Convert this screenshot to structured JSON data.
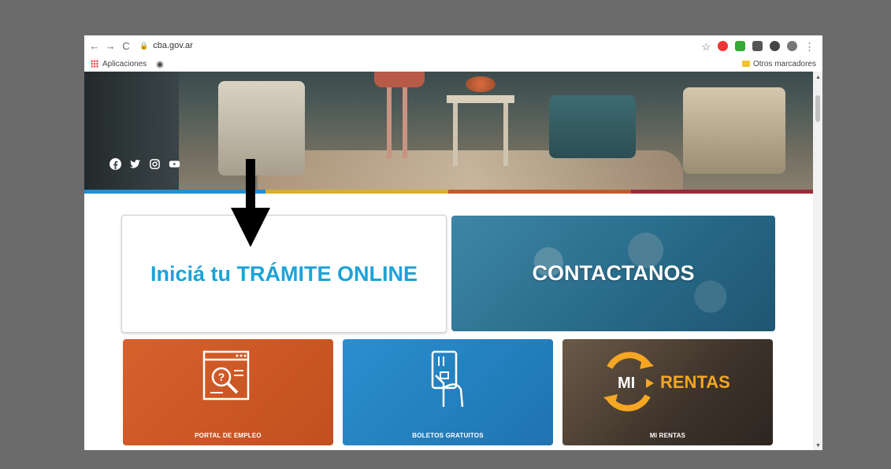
{
  "browser": {
    "nav": {
      "back": "←",
      "forward": "→",
      "reload": "C"
    },
    "url": "cba.gov.ar",
    "star": "☆",
    "menu": "⋮",
    "bookmarks": {
      "apps_label": "Aplicaciones",
      "other_label": "Otros marcadores"
    }
  },
  "hero": {
    "social": [
      "f",
      "t",
      "ig",
      "yt"
    ],
    "colorbar": [
      "#1f8fd6",
      "#d8b02a",
      "#c25a2a",
      "#9a2a3a"
    ]
  },
  "tiles": {
    "tramite": "Iniciá tu TRÁMITE ONLINE",
    "contact": "CONTACTANOS",
    "empleo": "PORTAL DE EMPLEO",
    "boletos": "BOLETOS GRATUITOS",
    "rentas": "MI RENTAS",
    "rentas_logo_mi": "MI",
    "rentas_logo_rentas": "RENTAS"
  },
  "colors": {
    "tramite_text": "#1ba3d8",
    "empleo": "#d7612b",
    "boletos": "#2a8fcf"
  }
}
